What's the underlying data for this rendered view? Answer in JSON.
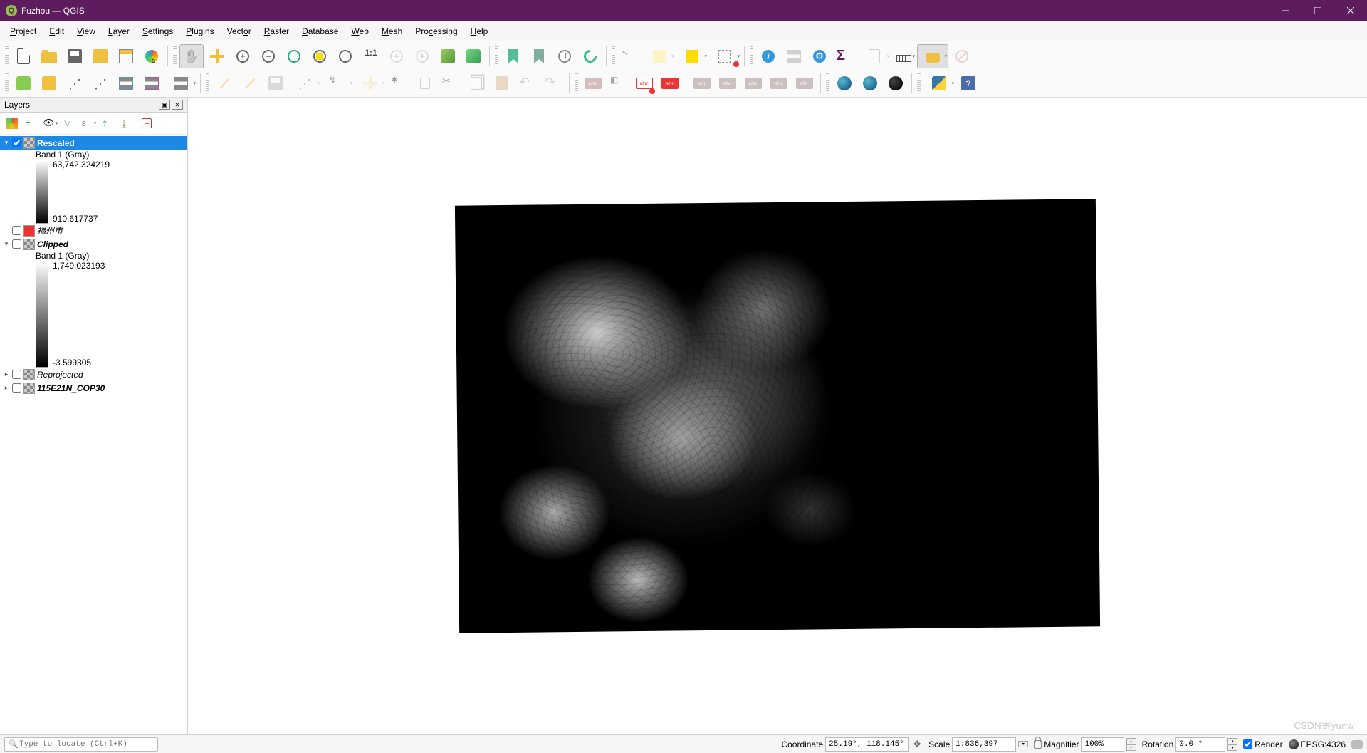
{
  "window": {
    "title": "Fuzhou — QGIS"
  },
  "menu": {
    "project": "Project",
    "edit": "Edit",
    "view": "View",
    "layer": "Layer",
    "settings": "Settings",
    "plugins": "Plugins",
    "vector": "Vector",
    "raster": "Raster",
    "database": "Database",
    "web": "Web",
    "mesh": "Mesh",
    "processing": "Processing",
    "help": "Help"
  },
  "panel": {
    "title": "Layers",
    "layers": [
      {
        "name": "Rescaled",
        "checked": true,
        "selected": true,
        "band": "Band 1 (Gray)",
        "min": "63,742.324219",
        "max": "910.617737"
      },
      {
        "name": "福州市",
        "checked": false
      },
      {
        "name": "Clipped",
        "checked": false,
        "band": "Band 1 (Gray)",
        "min": "1,749.023193",
        "max": "-3.599305"
      },
      {
        "name": "Reprojected",
        "checked": false
      },
      {
        "name": "115E21N_COP30",
        "checked": false
      }
    ]
  },
  "status": {
    "locator_ph": "Type to locate (Ctrl+K)",
    "coord_label": "Coordinate",
    "coord_value": "25.19°, 118.145°",
    "scale_label": "Scale",
    "scale_value": "1:836,397",
    "mag_label": "Magnifier",
    "mag_value": "100%",
    "rot_label": "Rotation",
    "rot_value": "0.0 °",
    "render": "Render",
    "epsg": "EPSG:4326"
  }
}
